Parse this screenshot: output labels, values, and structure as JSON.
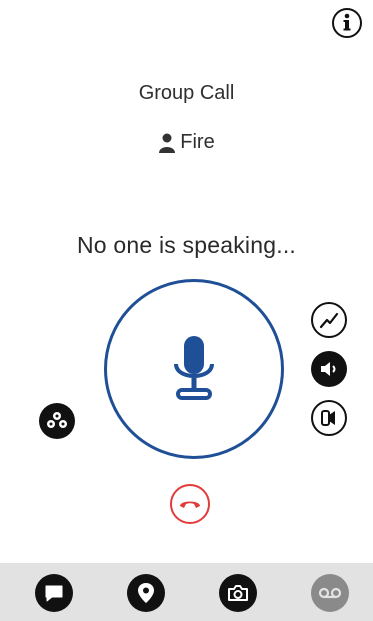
{
  "header": {
    "info_icon": "info-icon"
  },
  "call": {
    "type_label": "Group Call",
    "group_name": "Fire",
    "group_icon": "person-icon",
    "speaker_status": "No one is speaking..."
  },
  "controls": {
    "ptt_icon": "microphone-icon",
    "ptt_color": "#1f4f96",
    "end_call_color": "#e23b3b",
    "side_buttons": [
      {
        "name": "signal-icon"
      },
      {
        "name": "speaker-icon"
      },
      {
        "name": "earpiece-icon"
      },
      {
        "name": "map-pins-icon"
      }
    ]
  },
  "bottom_tabs": [
    {
      "name": "message-icon"
    },
    {
      "name": "location-pin-icon"
    },
    {
      "name": "camera-icon"
    },
    {
      "name": "voicemail-icon",
      "state": "disabled"
    }
  ]
}
